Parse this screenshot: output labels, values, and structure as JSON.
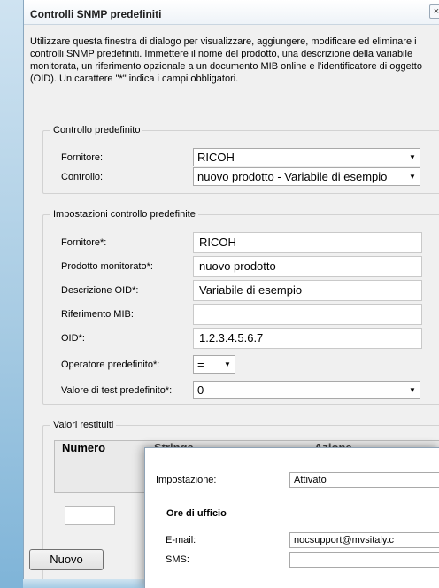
{
  "window": {
    "title": "Controlli SNMP predefiniti",
    "close_glyph": "×"
  },
  "intro_text": "Utilizzare questa finestra di dialogo per visualizzare, aggiungere, modificare ed eliminare i controlli SNMP predefiniti. Immettere il nome del prodotto, una descrizione della variabile monitorata, un riferimento opzionale a un documento MIB online e l'identificatore di oggetto (OID). Un carattere \"*\" indica i campi obbligatori.",
  "predefined_check": {
    "legend": "Controllo predefinito",
    "vendor_label": "Fornitore:",
    "vendor_value": "RICOH",
    "check_label": "Controllo:",
    "check_value": "nuovo prodotto - Variabile di esempio"
  },
  "settings": {
    "legend": "Impostazioni controllo predefinite",
    "vendor_label": "Fornitore*:",
    "vendor_value": "RICOH",
    "product_label": "Prodotto monitorato*:",
    "product_value": "nuovo prodotto",
    "oid_desc_label": "Descrizione OID*:",
    "oid_desc_value": "Variabile di esempio",
    "mib_label": "Riferimento MIB:",
    "mib_value": "",
    "oid_label": "OID*:",
    "oid_value": "1.2.3.4.5.6.7",
    "operator_label": "Operatore predefinito*:",
    "operator_value": "=",
    "test_value_label": "Valore di test predefinito*:",
    "test_value_value": "0"
  },
  "returned_values": {
    "legend": "Valori restituiti",
    "columns": [
      "Numero",
      "Stringa",
      "Azione"
    ]
  },
  "buttons": {
    "new_label": "Nuovo"
  },
  "overlay": {
    "setting_label": "Impostazione:",
    "setting_value": "Attivato",
    "office_hours_legend": "Ore di ufficio",
    "email_label": "E-mail:",
    "email_value": "nocsupport@mvsitaly.c",
    "sms_label": "SMS:",
    "sms_value": ""
  },
  "icons": {
    "dropdown": "chevron-down-icon",
    "close": "close-icon"
  },
  "colors": {
    "dialog_bg": "#f0f0f0",
    "frame_blue": "#a7cbe3"
  }
}
